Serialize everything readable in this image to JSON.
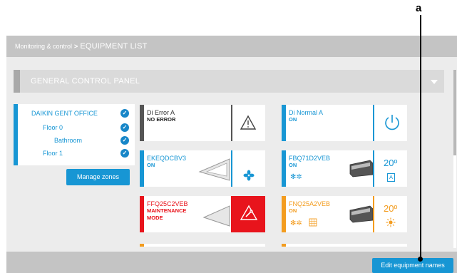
{
  "callout": {
    "label": "a"
  },
  "breadcrumb": {
    "parent": "Monitoring & control",
    "separator": ">",
    "current": "EQUIPMENT LIST"
  },
  "panel": {
    "title": "GENERAL CONTROL PANEL"
  },
  "zones": {
    "items": [
      {
        "label": "DAIKIN GENT OFFICE",
        "level": 0
      },
      {
        "label": "Floor 0",
        "level": 1
      },
      {
        "label": "Bathroom",
        "level": 2
      },
      {
        "label": "Floor 1",
        "level": 1
      }
    ],
    "manage_label": "Manage zones"
  },
  "cards": [
    {
      "name": "Di Error A",
      "status": [
        "NO ERROR"
      ],
      "bar_color": "#555555",
      "name_color": "#333333",
      "icon": "warning-triangle-icon"
    },
    {
      "name": "Di Normal A",
      "status": [
        "ON"
      ],
      "bar_color": "#1796d4",
      "name_color": "#1796d4",
      "icon": "power-icon"
    },
    {
      "name": "EKEQDCBV3",
      "status": [
        "ON"
      ],
      "bar_color": "#1796d4",
      "name_color": "#1796d4",
      "icon": "fan-icon"
    },
    {
      "name": "FBQ71D2VEB",
      "status": [
        "ON"
      ],
      "bar_color": "#1796d4",
      "name_color": "#1796d4",
      "icon": "ac-unit-icon",
      "temperature": "20º",
      "mode_icon": "auto-mode-icon",
      "badge": "A"
    },
    {
      "name": "FFQ25C2VEB",
      "status": [
        "MAINTENANCE",
        "MODE"
      ],
      "bar_color": "#e8141c",
      "name_color": "#e8141c",
      "icon": "maintenance-warning-icon"
    },
    {
      "name": "FNQ25A2VEB",
      "status": [
        "ON"
      ],
      "bar_color": "#f39c1e",
      "name_color": "#f39c1e",
      "icon": "ac-unit-icon",
      "temperature": "20º",
      "mode_icon": "heating-mode-icon"
    }
  ],
  "edit_button": {
    "label": "Edit equipment names"
  }
}
